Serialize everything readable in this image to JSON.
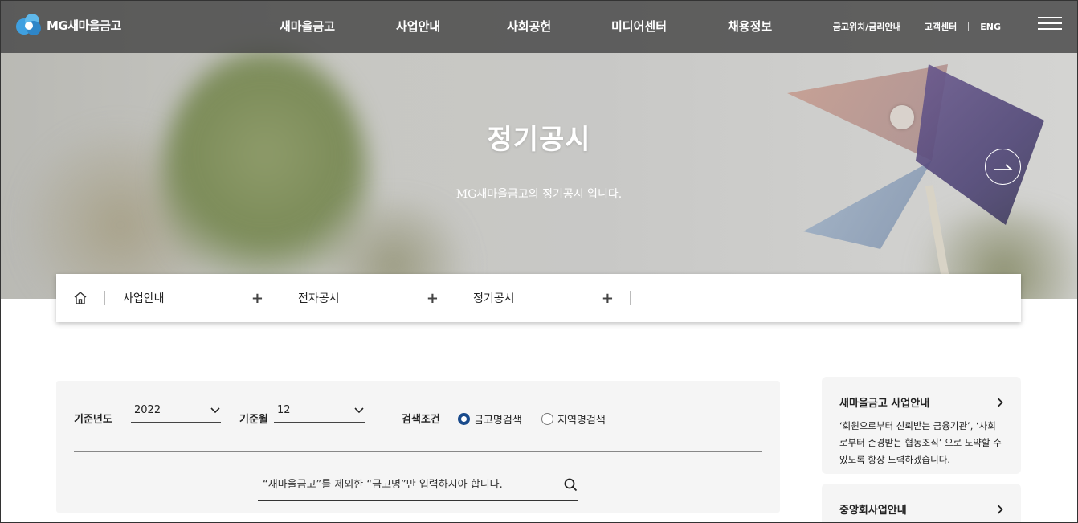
{
  "header": {
    "logo_text": "MG새마을금고",
    "nav": [
      "새마을금고",
      "사업안내",
      "사회공헌",
      "미디어센터",
      "채용정보"
    ],
    "util_links": [
      "금고위치/금리안내",
      "고객센터",
      "ENG"
    ]
  },
  "hero": {
    "title": "정기공시",
    "subtitle": "MG새마을금고의 정기공시 입니다."
  },
  "breadcrumb": {
    "items": [
      "사업안내",
      "전자공시",
      "정기공시"
    ],
    "expand_symbol": "+"
  },
  "search": {
    "year_label": "기준년도",
    "year_value": "2022",
    "month_label": "기준월",
    "month_value": "12",
    "condition_label": "검색조건",
    "options": [
      {
        "label": "금고명검색",
        "selected": true
      },
      {
        "label": "지역명검색",
        "selected": false
      }
    ],
    "placeholder": "“새마을금고”를 제외한 “금고명”만 입력하시아 합니다."
  },
  "side": {
    "cards": [
      {
        "title": "새마을금고 사업안내",
        "desc": "‘회원으로부터 신뢰받는 금융기관’, ‘사회로부터 존경받는 협동조직’ 으로 도약할 수 있도록 항상 노력하겠습니다."
      },
      {
        "title": "중앙회사업안내",
        "desc": ""
      }
    ]
  },
  "colors": {
    "header_bg": "#464646",
    "radio_accent": "#1a4b8c",
    "panel_bg": "#f5f5f5",
    "logo_blue": "#3fa0e0"
  }
}
